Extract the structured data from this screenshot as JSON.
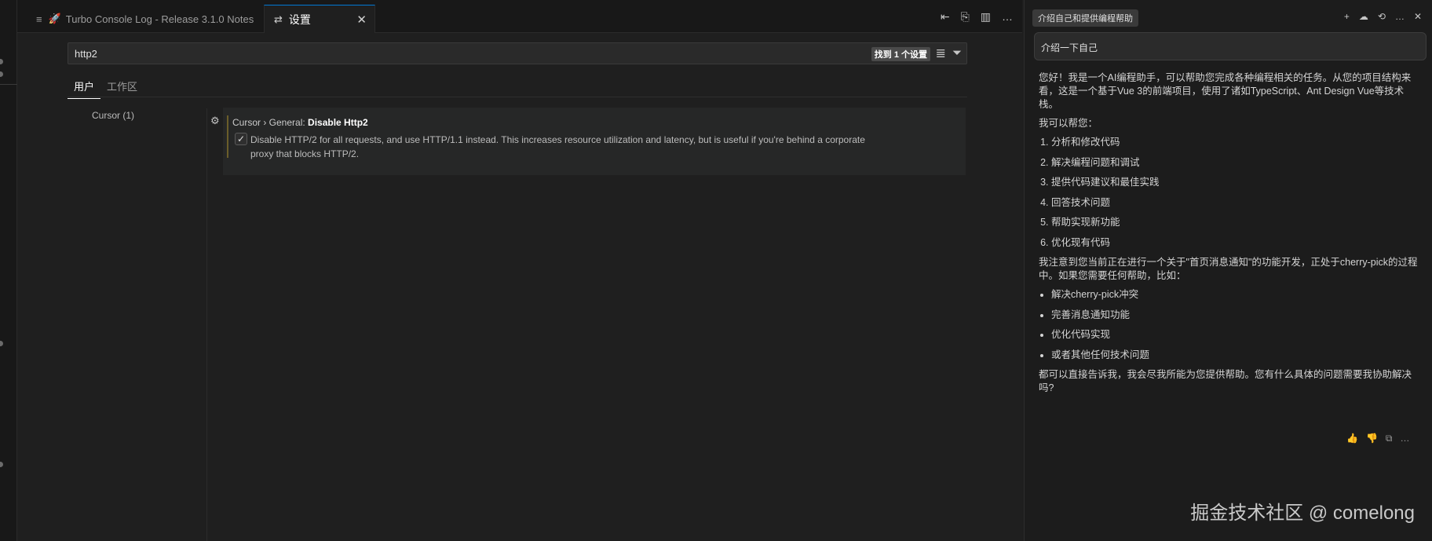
{
  "tabs": [
    {
      "icon": "list-icon",
      "icon_glyph": "≡",
      "badge_glyph": "🚀",
      "label": "Turbo Console Log - Release 3.1.0 Notes"
    },
    {
      "icon": "settings-icon",
      "icon_glyph": "⇄",
      "label": "设置",
      "close_glyph": "✕"
    }
  ],
  "editor_actions": [
    "⇤",
    "⎘",
    "▥",
    "…"
  ],
  "settings": {
    "search_value": "http2",
    "found_text": "找到 1 个设置",
    "filter_icons": [
      "≣",
      "⏷"
    ],
    "scopes": [
      "用户",
      "工作区"
    ],
    "toc_item": "Cursor (1)",
    "item": {
      "breadcrumb": "Cursor › General: ",
      "name": "Disable Http2",
      "checked": true,
      "check_glyph": "✓",
      "gear_glyph": "⚙",
      "description": "Disable HTTP/2 for all requests, and use HTTP/1.1 instead. This increases resource utilization and latency, but is useful if you're behind a corporate proxy that blocks HTTP/2."
    }
  },
  "chat": {
    "title": "介绍自己和提供编程帮助",
    "header_actions": [
      "+",
      "☁",
      "⟲",
      "…",
      "✕"
    ],
    "user_message": "介绍一下自己",
    "intro": "您好！我是一个AI编程助手，可以帮助您完成各种编程相关的任务。从您的项目结构来看，这是一个基于Vue 3的前端项目，使用了诸如TypeScript、Ant Design Vue等技术栈。",
    "can_help": "我可以帮您：",
    "help_items": [
      "分析和修改代码",
      "解决编程问题和调试",
      "提供代码建议和最佳实践",
      "回答技术问题",
      "帮助实现新功能",
      "优化现有代码"
    ],
    "notice": "我注意到您当前正在进行一个关于\"首页消息通知\"的功能开发，正处于cherry-pick的过程中。如果您需要任何帮助，比如：",
    "bullets": [
      "解决cherry-pick冲突",
      "完善消息通知功能",
      "优化代码实现",
      "或者其他任何技术问题"
    ],
    "closing": "都可以直接告诉我，我会尽我所能为您提供帮助。您有什么具体的问题需要我协助解决吗?",
    "feedback_icons": [
      "👍",
      "👎",
      "⧉",
      "…"
    ]
  },
  "watermark": "掘金技术社区 @ comelong"
}
